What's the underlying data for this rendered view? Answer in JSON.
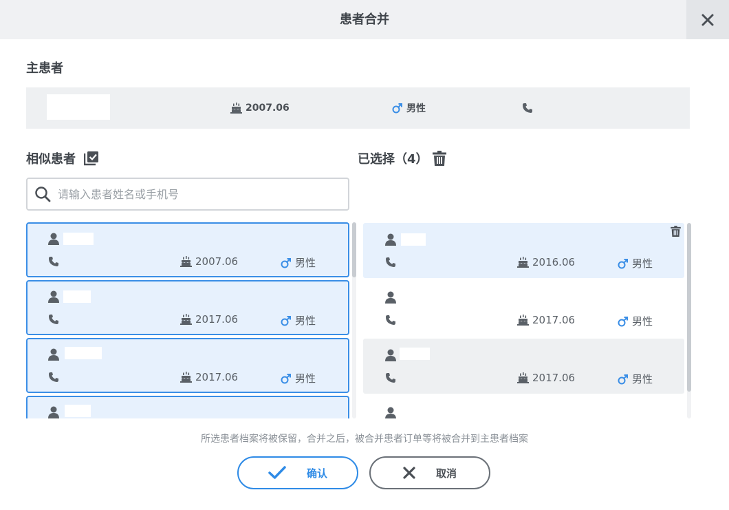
{
  "dialog": {
    "title": "患者合并"
  },
  "main_patient": {
    "section_title": "主患者",
    "birth": "2007.06",
    "gender": "男性"
  },
  "similar": {
    "section_title": "相似患者",
    "search_placeholder": "请输入患者姓名或手机号",
    "items": [
      {
        "birth": "2007.06",
        "gender": "男性"
      },
      {
        "birth": "2017.06",
        "gender": "男性"
      },
      {
        "birth": "2017.06",
        "gender": "男性"
      }
    ]
  },
  "selected": {
    "section_title": "已选择（4）",
    "items": [
      {
        "birth": "2016.06",
        "gender": "男性"
      },
      {
        "birth": "2017.06",
        "gender": "男性"
      },
      {
        "birth": "2017.06",
        "gender": "男性"
      }
    ]
  },
  "footer": {
    "note": "所选患者档案将被保留，合并之后，被合并患者订单等将被合并到主患者档案",
    "confirm_label": "确认",
    "cancel_label": "取消"
  },
  "colors": {
    "accent": "#2f8be6",
    "male_symbol": "#3a8ee6",
    "card_selected_bg": "#e7f1fd",
    "card_grey_bg": "#eef0f2"
  }
}
